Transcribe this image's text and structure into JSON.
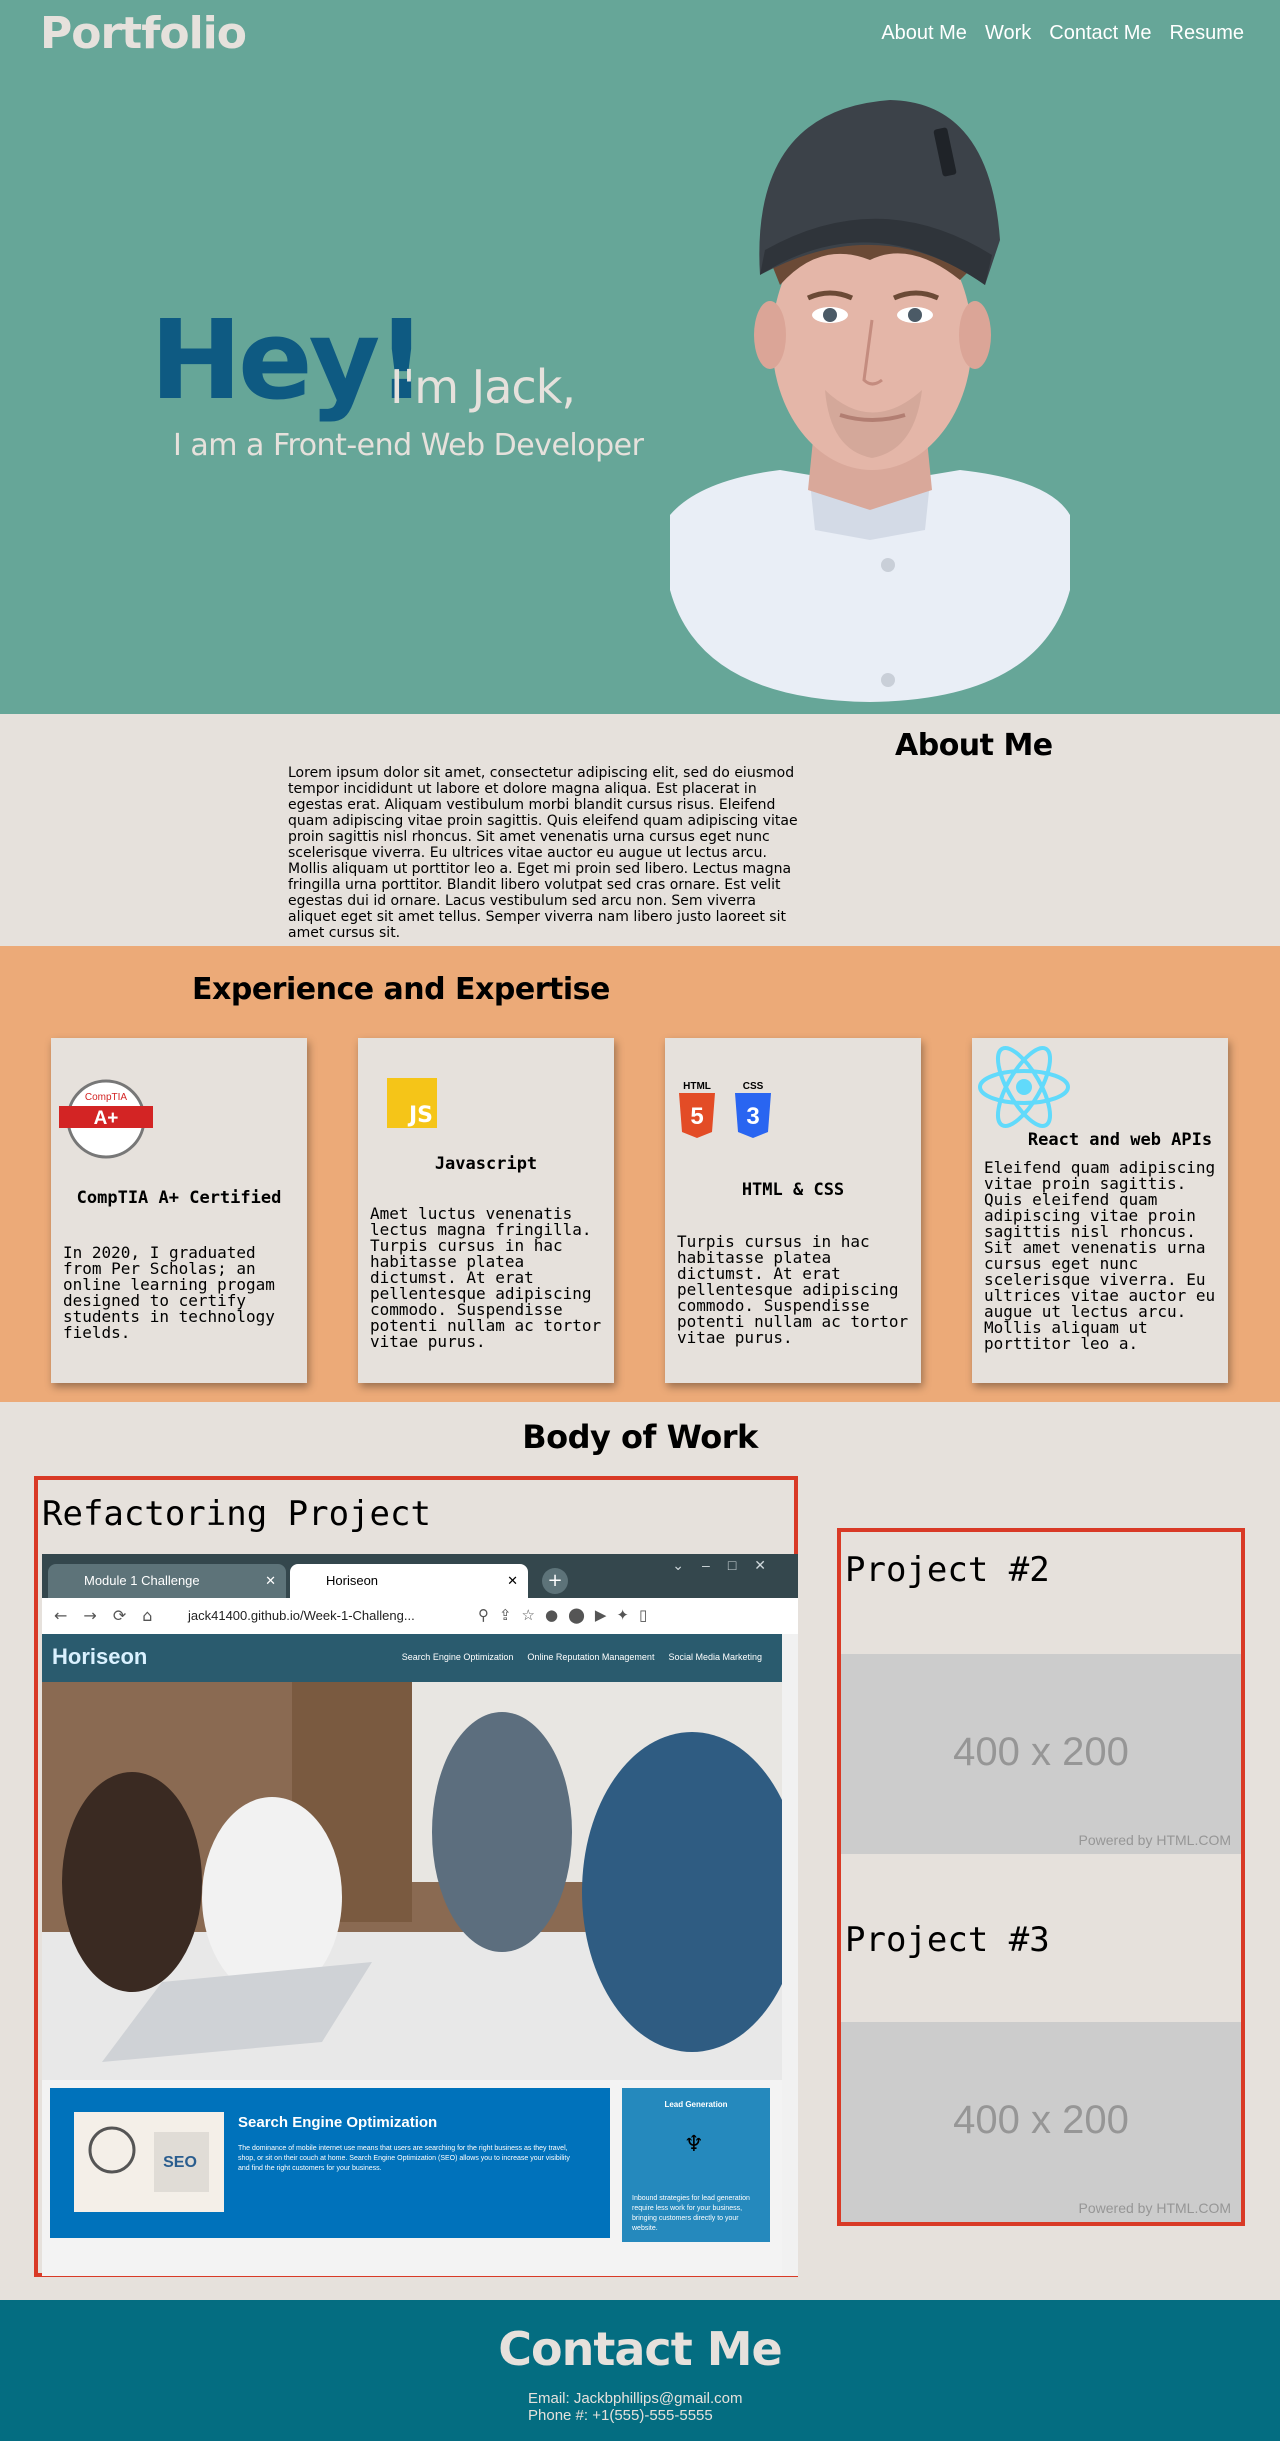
{
  "header": {
    "logo": "Portfolio",
    "nav": [
      "About Me",
      "Work",
      "Contact Me",
      "Resume"
    ]
  },
  "hero": {
    "greeting": "Hey!",
    "name_line": "I'm Jack,",
    "subtitle": "I am a Front-end Web Developer"
  },
  "about": {
    "title": "About Me",
    "body": "Lorem ipsum dolor sit amet, consectetur adipiscing elit, sed do eiusmod tempor incididunt ut labore et dolore magna aliqua. Est placerat in egestas erat. Aliquam vestibulum morbi blandit cursus risus. Eleifend quam adipiscing vitae proin sagittis. Quis eleifend quam adipiscing vitae proin sagittis nisl rhoncus. Sit amet venenatis urna cursus eget nunc scelerisque viverra. Eu ultrices vitae auctor eu augue ut lectus arcu. Mollis aliquam ut porttitor leo a. Eget mi proin sed libero. Lectus magna fringilla urna porttitor. Blandit libero volutpat sed cras ornare. Est velit egestas dui id ornare. Lacus vestibulum sed arcu non. Sem viverra aliquet eget sit amet tellus. Semper viverra nam libero justo laoreet sit amet cursus sit."
  },
  "experience": {
    "title": "Experience and Expertise",
    "cards": [
      {
        "title": "CompTIA A+ Certified",
        "badge_top": "CompTIA",
        "badge": "A+",
        "body": "In 2020, I graduated from Per Scholas; an online learning progam designed to certify students in technology fields."
      },
      {
        "title": "Javascript",
        "badge": "JS",
        "body": "Amet luctus venenatis lectus magna fringilla. Turpis cursus in hac habitasse platea dictumst. At erat pellentesque adipiscing commodo. Suspendisse potenti nullam ac tortor vitae purus."
      },
      {
        "title": "HTML & CSS",
        "badge_html": "HTML",
        "badge_css": "CSS",
        "num_html": "5",
        "num_css": "3",
        "body": "Turpis cursus in hac habitasse platea dictumst. At erat pellentesque adipiscing commodo. Suspendisse potenti nullam ac tortor vitae purus."
      },
      {
        "title": "React and web APIs",
        "body": "Eleifend quam adipiscing vitae proin sagittis. Quis eleifend quam adipiscing vitae proin sagittis nisl rhoncus. Sit amet venenatis urna cursus eget nunc scelerisque viverra. Eu ultrices vitae auctor eu augue ut lectus arcu. Mollis aliquam ut porttitor leo a."
      }
    ]
  },
  "work": {
    "title": "Body of Work",
    "main_project": {
      "title": "Refactoring Project",
      "screenshot": {
        "tabs": [
          "Module 1 Challenge",
          "Horiseon"
        ],
        "url": "jack41400.github.io/Week-1-Challeng...",
        "brand": "Horiseon",
        "nav": [
          "Search Engine Optimization",
          "Online Reputation Management",
          "Social Media Marketing"
        ],
        "seo_title": "Search Engine Optimization",
        "seo_text": "The dominance of mobile internet use means that users are searching for the right business as they travel, shop, or sit on their couch at home. Search Engine Optimization (SEO) allows you to increase your visibility and find the right customers for your business.",
        "seo_badge": "SEO",
        "lead_title": "Lead Generation",
        "lead_text": "Inbound strategies for lead generation require less work for your business, bringing customers directly to your website."
      }
    },
    "side_projects": [
      {
        "title": "Project #2",
        "placeholder": "400 x 200",
        "powered": "Powered by HTML.COM"
      },
      {
        "title": "Project #3",
        "placeholder": "400 x 200",
        "powered": "Powered by HTML.COM"
      }
    ]
  },
  "contact": {
    "title": "Contact Me",
    "email": "Email: Jackbphillips@gmail.com",
    "phone": "Phone #: +1(555)-555-5555"
  },
  "colors": {
    "hero_bg": "#66a698",
    "hey": "#0e5a82",
    "page_bg": "#e6e1dc",
    "experience_bg": "#ecaa78",
    "project_border": "#d93a26",
    "contact_bg": "#046d81"
  }
}
